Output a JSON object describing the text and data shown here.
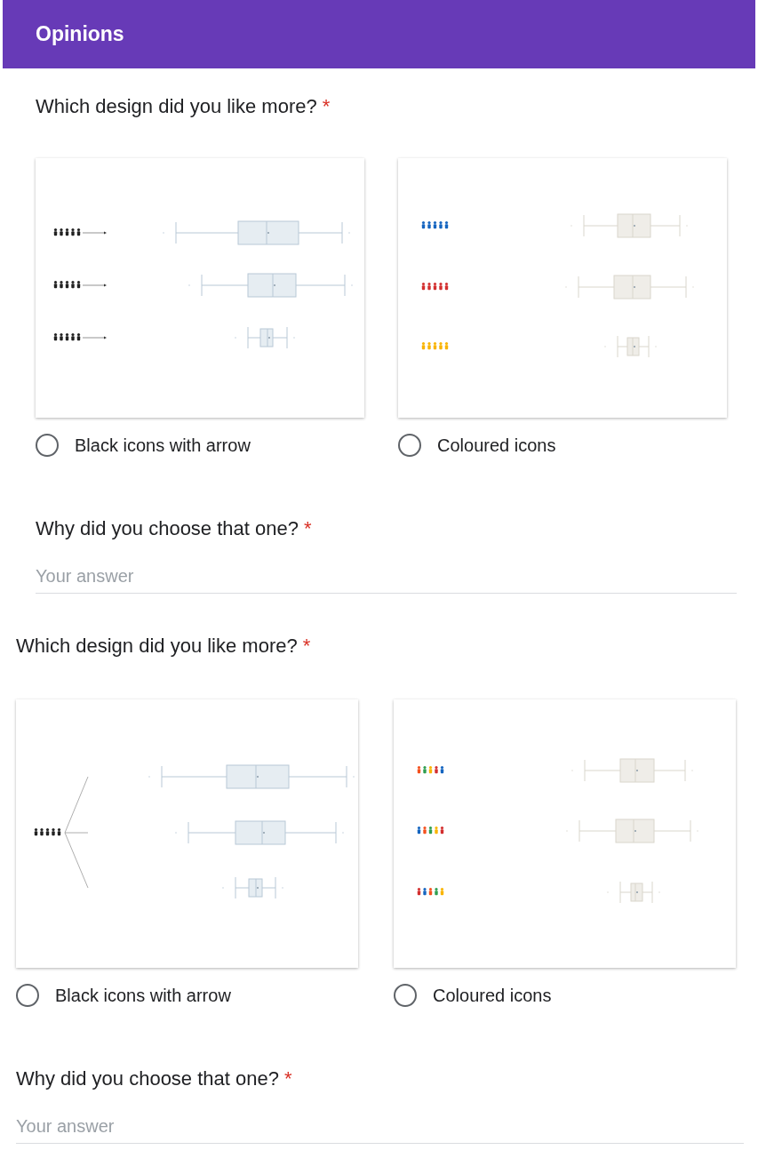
{
  "header": {
    "title": "Opinions"
  },
  "questions": [
    {
      "kind": "choice",
      "title": "Which design did you like more?",
      "required_mark": "*",
      "options": [
        {
          "label": "Black icons with arrow",
          "selected": false,
          "kind": "arrow"
        },
        {
          "label": "Coloured icons",
          "selected": false,
          "kind": "coloured"
        }
      ]
    },
    {
      "kind": "text",
      "title": "Why did you choose that one?",
      "required_mark": "*",
      "placeholder": "Your answer"
    },
    {
      "kind": "choice",
      "title": "Which design did you like more?",
      "required_mark": "*",
      "options": [
        {
          "label": "Black icons with arrow",
          "selected": false,
          "kind": "branch"
        },
        {
          "label": "Coloured icons",
          "selected": false,
          "kind": "mixed"
        }
      ]
    },
    {
      "kind": "text",
      "title": "Why did you choose that one?",
      "required_mark": "*",
      "placeholder": "Your answer"
    }
  ]
}
